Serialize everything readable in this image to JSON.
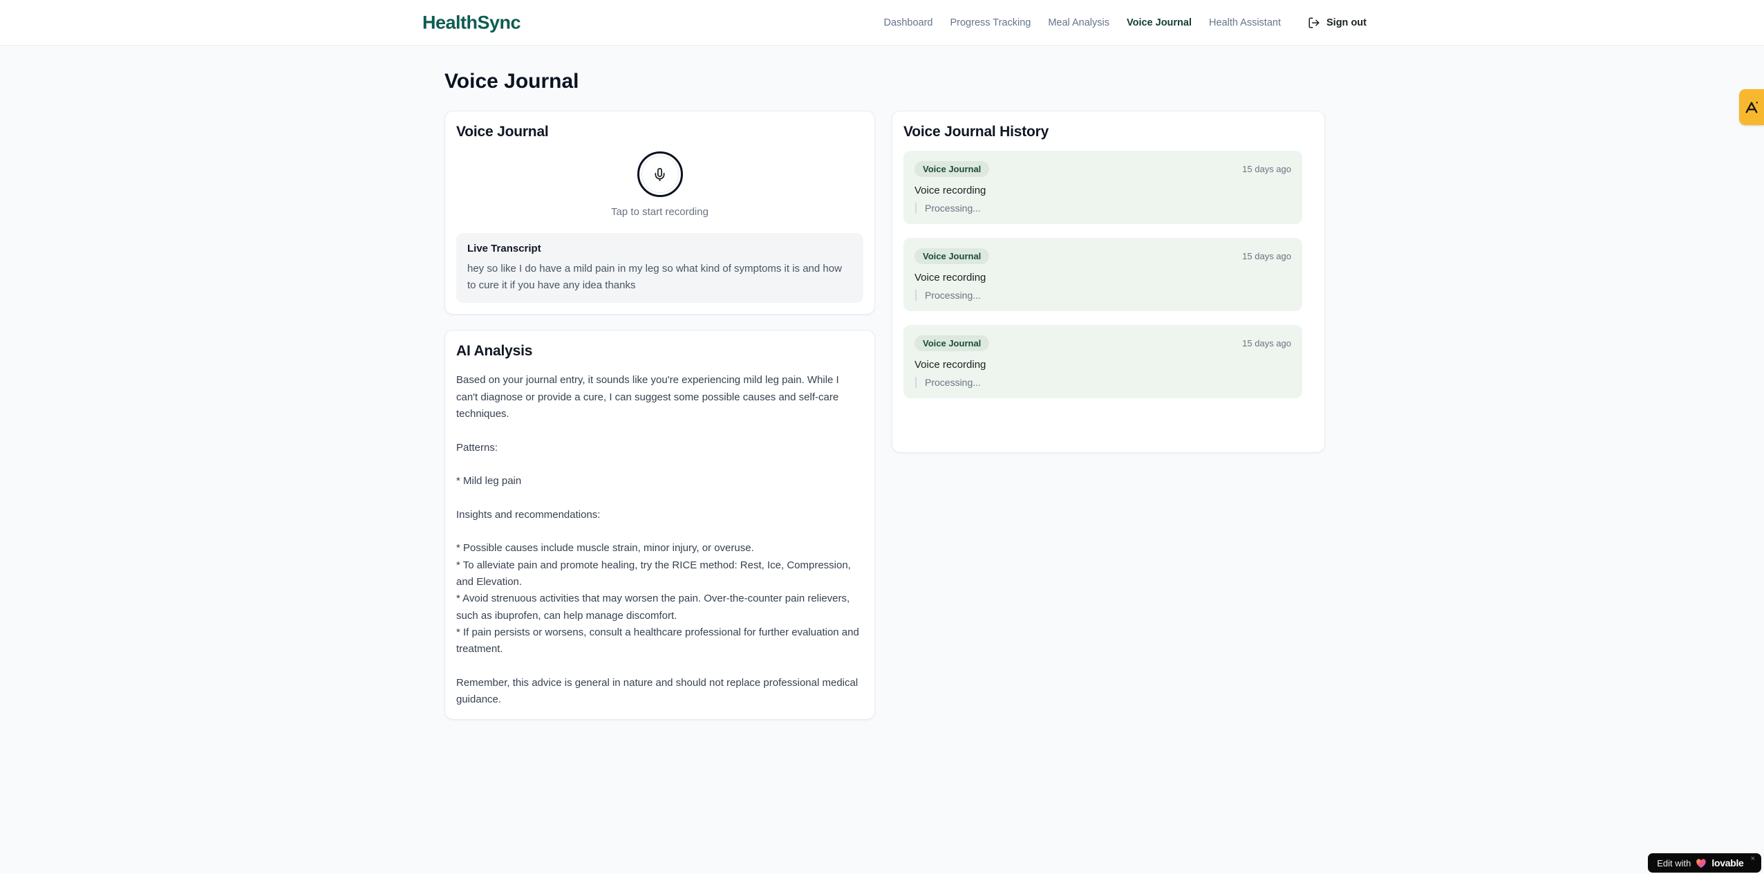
{
  "header": {
    "brand": "HealthSync",
    "nav": [
      {
        "label": "Dashboard",
        "active": false
      },
      {
        "label": "Progress Tracking",
        "active": false
      },
      {
        "label": "Meal Analysis",
        "active": false
      },
      {
        "label": "Voice Journal",
        "active": true
      },
      {
        "label": "Health Assistant",
        "active": false
      }
    ],
    "sign_out_label": "Sign out",
    "sign_out_icon": "logout-icon"
  },
  "page": {
    "title": "Voice Journal"
  },
  "recorder": {
    "card_title": "Voice Journal",
    "mic_icon": "microphone-icon",
    "tap_hint": "Tap to start recording",
    "transcript_title": "Live Transcript",
    "transcript_text": "hey so like I do have a mild pain in my leg so what kind of symptoms it is and how to cure it if you have any idea thanks"
  },
  "analysis": {
    "card_title": "AI Analysis",
    "body": "Based on your journal entry, it sounds like you're experiencing mild leg pain. While I can't diagnose or provide a cure, I can suggest some possible causes and self-care techniques.\n\nPatterns:\n\n* Mild leg pain\n\nInsights and recommendations:\n\n* Possible causes include muscle strain, minor injury, or overuse.\n* To alleviate pain and promote healing, try the RICE method: Rest, Ice, Compression, and Elevation.\n* Avoid strenuous activities that may worsen the pain. Over-the-counter pain relievers, such as ibuprofen, can help manage discomfort.\n* If pain persists or worsens, consult a healthcare professional for further evaluation and treatment.\n\nRemember, this advice is general in nature and should not replace professional medical guidance."
  },
  "history": {
    "card_title": "Voice Journal History",
    "entries": [
      {
        "badge": "Voice Journal",
        "time": "15 days ago",
        "title": "Voice recording",
        "status": "Processing..."
      },
      {
        "badge": "Voice Journal",
        "time": "15 days ago",
        "title": "Voice recording",
        "status": "Processing..."
      },
      {
        "badge": "Voice Journal",
        "time": "15 days ago",
        "title": "Voice recording",
        "status": "Processing..."
      }
    ]
  },
  "widgets": {
    "side_tab_icon": "amber-logo-icon",
    "lovable": {
      "prefix": "Edit with",
      "brand": "lovable",
      "heart_icon": "heart-icon",
      "close": "×"
    }
  },
  "colors": {
    "brand_teal": "#0d5c51",
    "nav_active": "#113c35",
    "page_bg": "#f8fafc",
    "card_border": "#e8ebf0",
    "entry_bg": "#eef5ef",
    "badge_bg": "#dde9df",
    "badge_text": "#1d4b39",
    "side_tab_amber": "#f7b82f",
    "lovable_bg": "#0a0a0a"
  }
}
